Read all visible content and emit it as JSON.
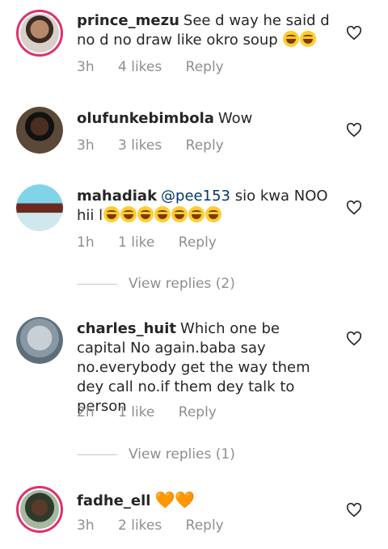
{
  "comments": [
    {
      "username": "prince_mezu",
      "text": "See d way he said d no d no draw like okro soup",
      "emoji": "😂😊",
      "time": "3h",
      "likes": "4 likes",
      "reply": "Reply"
    },
    {
      "username": "olufunkebimbola",
      "text": "Wow",
      "time": "3h",
      "likes": "3 likes",
      "reply": "Reply"
    },
    {
      "username": "mahadiak",
      "mention": "@pee153",
      "text": "sio kwa NOO hii l",
      "emoji": "😂😂😂😂😂😂😂",
      "time": "1h",
      "likes": "1 like",
      "reply": "Reply",
      "view_replies": "View replies (2)"
    },
    {
      "username": "charles_huit",
      "text": "Which one be capital No again.baba say no.everybody get the way them dey call no.if them dey talk to person",
      "time": "2h",
      "likes": "1 like",
      "reply": "Reply",
      "view_replies": "View replies (1)"
    },
    {
      "username": "fadhe_ell",
      "text": "🧡🧡",
      "time": "3h",
      "likes": "2 likes",
      "reply": "Reply"
    }
  ],
  "icons": {
    "like": "heart-outline-icon"
  },
  "colors": {
    "meta": "#8e8e8e",
    "mention": "#00376b",
    "story_ring": "#e1306c"
  }
}
